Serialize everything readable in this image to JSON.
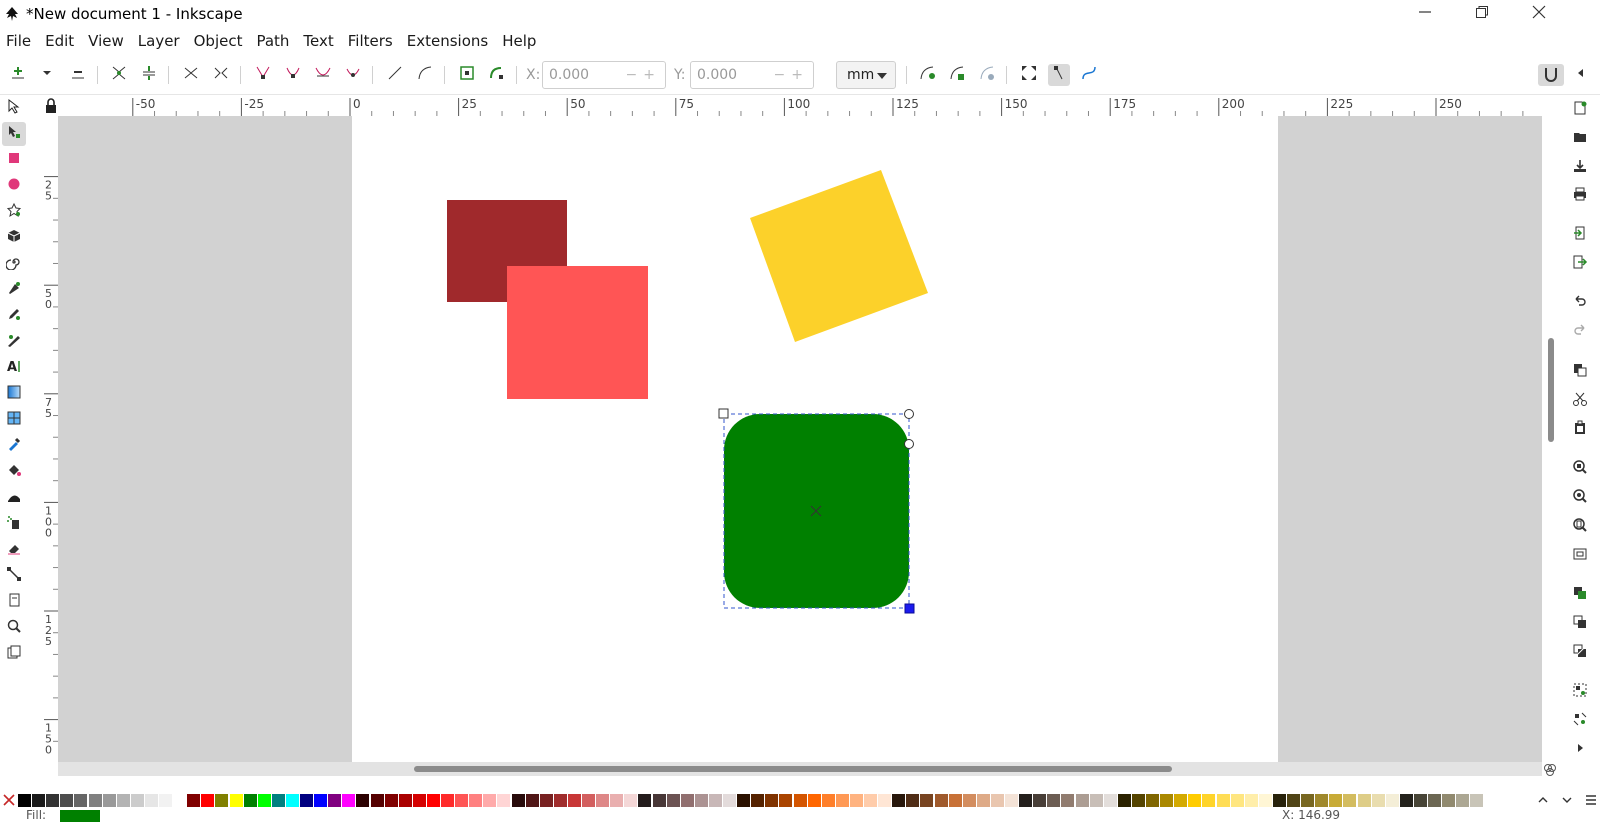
{
  "window": {
    "title": "*New document 1 - Inkscape",
    "controls": [
      "minimize",
      "restore",
      "close"
    ]
  },
  "menu": [
    "File",
    "Edit",
    "View",
    "Layer",
    "Object",
    "Path",
    "Text",
    "Filters",
    "Extensions",
    "Help"
  ],
  "node_toolbar": {
    "x_label": "X:",
    "x_value": "0.000",
    "y_label": "Y:",
    "y_value": "0.000",
    "unit": "mm",
    "icons": [
      "insert-node-icon",
      "insert-node-menu-icon",
      "delete-node-icon",
      "join-nodes-icon",
      "break-path-icon",
      "join-segment-icon",
      "delete-segment-icon",
      "node-cusp-icon",
      "node-smooth-icon",
      "node-symmetric-icon",
      "node-auto-icon",
      "segment-line-icon",
      "segment-curve-icon",
      "object-to-path-icon",
      "stroke-to-path-icon",
      "path-effect-icon",
      "clip-path-icon",
      "mask-path-icon",
      "show-transform-handles-icon",
      "show-handles-icon",
      "show-outline-icon"
    ]
  },
  "rulers": {
    "horizontal_ticks": [
      "-50",
      "-25",
      "0",
      "25",
      "50",
      "75",
      "100",
      "125",
      "150",
      "175",
      "200",
      "225",
      "250"
    ],
    "vertical_ticks": [
      "25",
      "50",
      "75",
      "100",
      "125",
      "150"
    ]
  },
  "tools": [
    "selector-icon",
    "node-tool-icon",
    "rectangle-tool-icon",
    "ellipse-tool-icon",
    "star-tool-icon",
    "3d-box-tool-icon",
    "spiral-tool-icon",
    "pen-tool-icon",
    "pencil-tool-icon",
    "calligraphy-tool-icon",
    "text-tool-icon",
    "gradient-tool-icon",
    "mesh-tool-icon",
    "dropper-tool-icon",
    "paint-bucket-icon",
    "tweak-tool-icon",
    "spray-tool-icon",
    "eraser-tool-icon",
    "connector-tool-icon",
    "pages-tool-icon",
    "zoom-tool-icon",
    "measure-tool-icon"
  ],
  "commands": [
    "new-document-icon",
    "open-file-icon",
    "save-icon",
    "print-icon",
    "import-icon",
    "export-icon",
    "undo-icon",
    "redo-icon",
    "copy-icon",
    "cut-icon",
    "paste-icon",
    "zoom-selection-icon",
    "zoom-drawing-icon",
    "zoom-page-icon",
    "zoom-page-width-icon",
    "duplicate-icon",
    "clone-icon",
    "unlink-clone-icon",
    "group-icon",
    "ungroup-icon",
    "more-icon"
  ],
  "canvas": {
    "objects": [
      {
        "name": "dark-red-square",
        "color": "#a0292c"
      },
      {
        "name": "salmon-square",
        "color": "#ff5555"
      },
      {
        "name": "yellow-rotated-square",
        "color": "#fcd12a"
      },
      {
        "name": "green-rounded-rect",
        "color": "#008000",
        "selected": true
      }
    ]
  },
  "palette": {
    "none_icon": "none-color-icon",
    "colors": [
      "#000000",
      "#1a1a1a",
      "#333333",
      "#4d4d4d",
      "#666666",
      "#808080",
      "#999999",
      "#b3b3b3",
      "#cccccc",
      "#e6e6e6",
      "#f2f2f2",
      "#ffffff",
      "#800000",
      "#ff0000",
      "#808000",
      "#ffff00",
      "#008000",
      "#00ff00",
      "#008080",
      "#00ffff",
      "#000080",
      "#0000ff",
      "#800080",
      "#ff00ff",
      "#2b0000",
      "#550000",
      "#800000",
      "#aa0000",
      "#d40000",
      "#ff0000",
      "#ff2a2a",
      "#ff5555",
      "#ff8080",
      "#ffaaaa",
      "#ffd5d5",
      "#280b0b",
      "#501616",
      "#782121",
      "#a02c2c",
      "#c83737",
      "#d35f5f",
      "#de8787",
      "#e9afaf",
      "#f4d7d7",
      "#241c1c",
      "#483737",
      "#6c5353",
      "#916f6f",
      "#ac9393",
      "#c8b7b7",
      "#e3dbdb",
      "#2b1100",
      "#552200",
      "#803300",
      "#aa4400",
      "#d45500",
      "#ff6600",
      "#ff7f2a",
      "#ff9955",
      "#ffb380",
      "#ffccaa",
      "#ffe6d5",
      "#28170b",
      "#502d16",
      "#784421",
      "#a05a2c",
      "#c87137",
      "#d38d5f",
      "#deaa87",
      "#e9c6af",
      "#f4e3d7",
      "#241f1c",
      "#483e37",
      "#6c5d53",
      "#917c6f",
      "#ac9d93",
      "#c8beb7",
      "#e3dedb",
      "#2b2200",
      "#554400",
      "#806600",
      "#aa8800",
      "#d4aa00",
      "#ffcc00",
      "#ffd42a",
      "#ffdd55",
      "#ffe680",
      "#ffeeaa",
      "#fff6d5",
      "#28220b",
      "#504416",
      "#786721",
      "#a0892c",
      "#c8ab37",
      "#d3bc5f",
      "#decd87",
      "#e9ddaf",
      "#f4eed7",
      "#24221c",
      "#484537",
      "#6c6753",
      "#918a6f",
      "#aca793",
      "#c8c4b7"
    ]
  },
  "status": {
    "fill_label": "Fill:",
    "fill_color": "#008000",
    "x_readout": "X: 146.99"
  }
}
